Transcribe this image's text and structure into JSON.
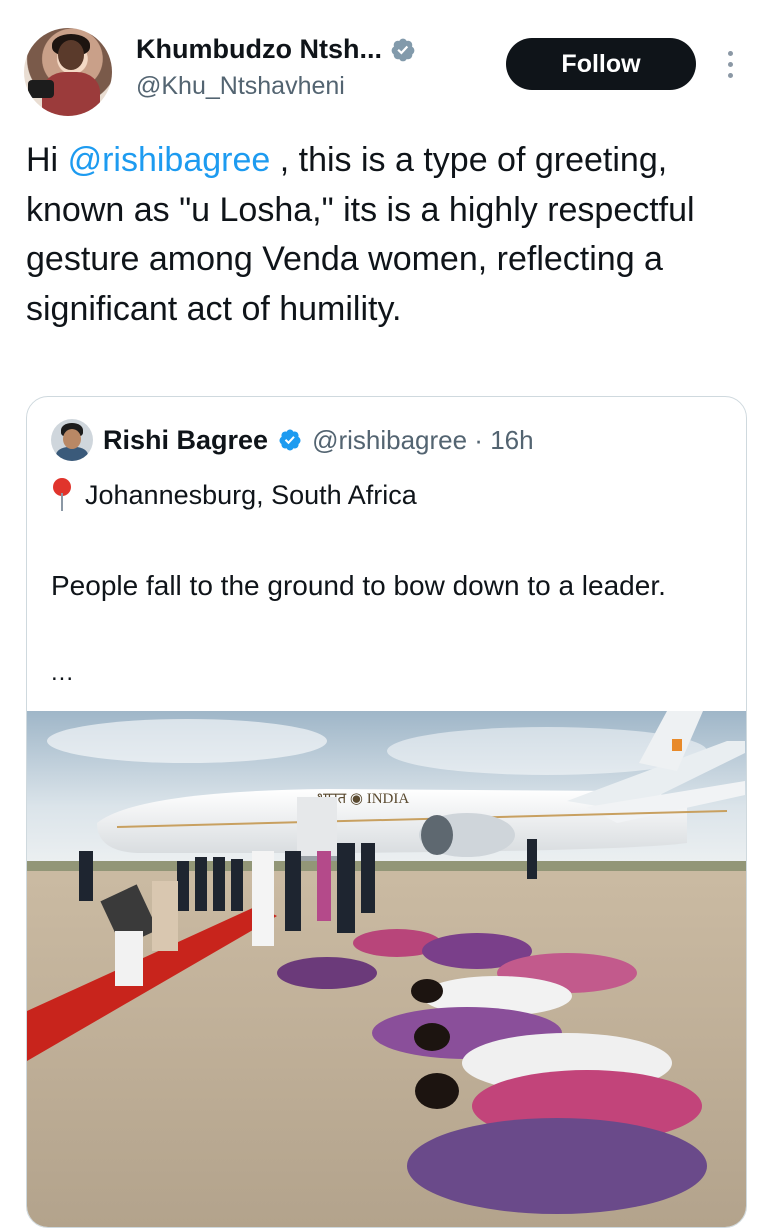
{
  "tweet": {
    "display_name": "Khumbudzo Ntsh...",
    "handle": "@Khu_Ntshavheni",
    "follow_label": "Follow",
    "text_prefix": "Hi ",
    "mention": "@rishibagree",
    "text_body": " , this is a type of greeting, known as \"u Losha,\" its is a highly respectful gesture among Venda women, reflecting a significant act of humility."
  },
  "quoted": {
    "display_name": "Rishi Bagree",
    "meta": "@rishibagree · 16h",
    "location": "Johannesburg, South Africa",
    "text": " People fall to the ground to bow down to a leader.",
    "ellipsis": "...",
    "photo_caption_text": "भारत ◉ INDIA"
  },
  "colors": {
    "verified": "#1d9bf0",
    "accent": "#1d9bf0",
    "follow_bg": "#0f1419",
    "secondary_text": "#536471",
    "red_carpet": "#c8241c"
  },
  "icons": {
    "verified": "verified-badge-icon",
    "more": "more-vertical-icon",
    "location": "location-pin-icon"
  }
}
